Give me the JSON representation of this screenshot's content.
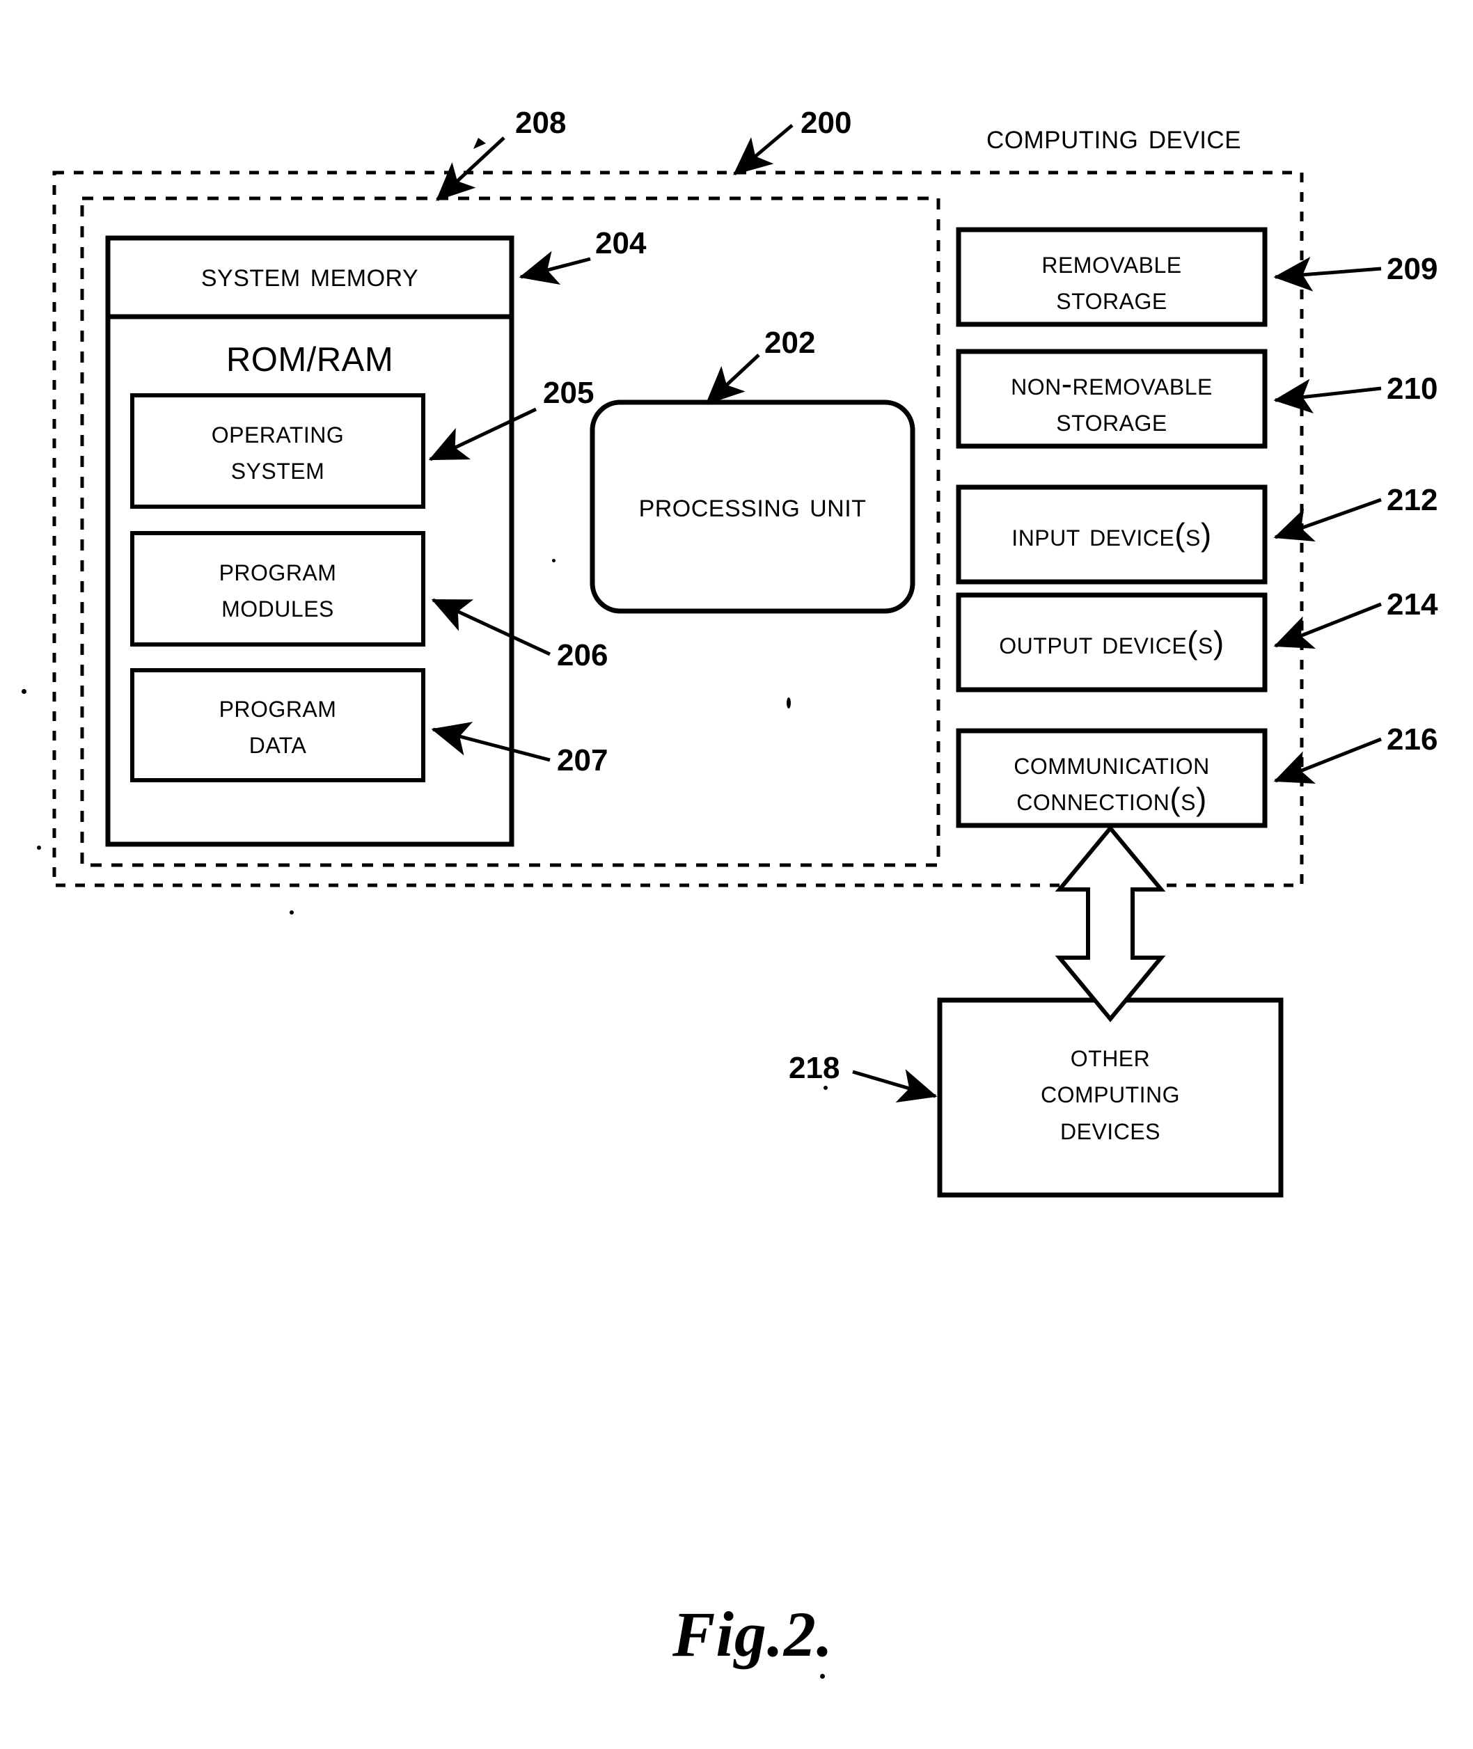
{
  "figure": {
    "caption": "Fig.2.",
    "title": "Computing Device"
  },
  "outer_enclosure": {
    "label": "Computing Device",
    "ref": "200",
    "style": "dashed"
  },
  "inner_enclosure": {
    "ref": "208",
    "style": "dashed"
  },
  "memory": {
    "header": "System Memory",
    "header_ref": "204",
    "subtitle": "ROM/RAM",
    "blocks": [
      {
        "label": "Operating\nSystem",
        "ref": "205"
      },
      {
        "label": "Program\nModules",
        "ref": "206"
      },
      {
        "label": "Program\nData",
        "ref": "207"
      }
    ]
  },
  "processing_unit": {
    "label": "Processing Unit",
    "ref": "202"
  },
  "peripherals": [
    {
      "label": "Removable\nStorage",
      "ref": "209"
    },
    {
      "label": "Non-Removable\nStorage",
      "ref": "210"
    },
    {
      "label": "Input Device(s)",
      "ref": "212"
    },
    {
      "label": "Output Device(s)",
      "ref": "214"
    },
    {
      "label": "Communication\nConnection(s)",
      "ref": "216"
    }
  ],
  "external": {
    "label": "Other\nComputing\nDevices",
    "ref": "218"
  },
  "colors": {
    "ink": "#000000",
    "paper": "#ffffff"
  }
}
